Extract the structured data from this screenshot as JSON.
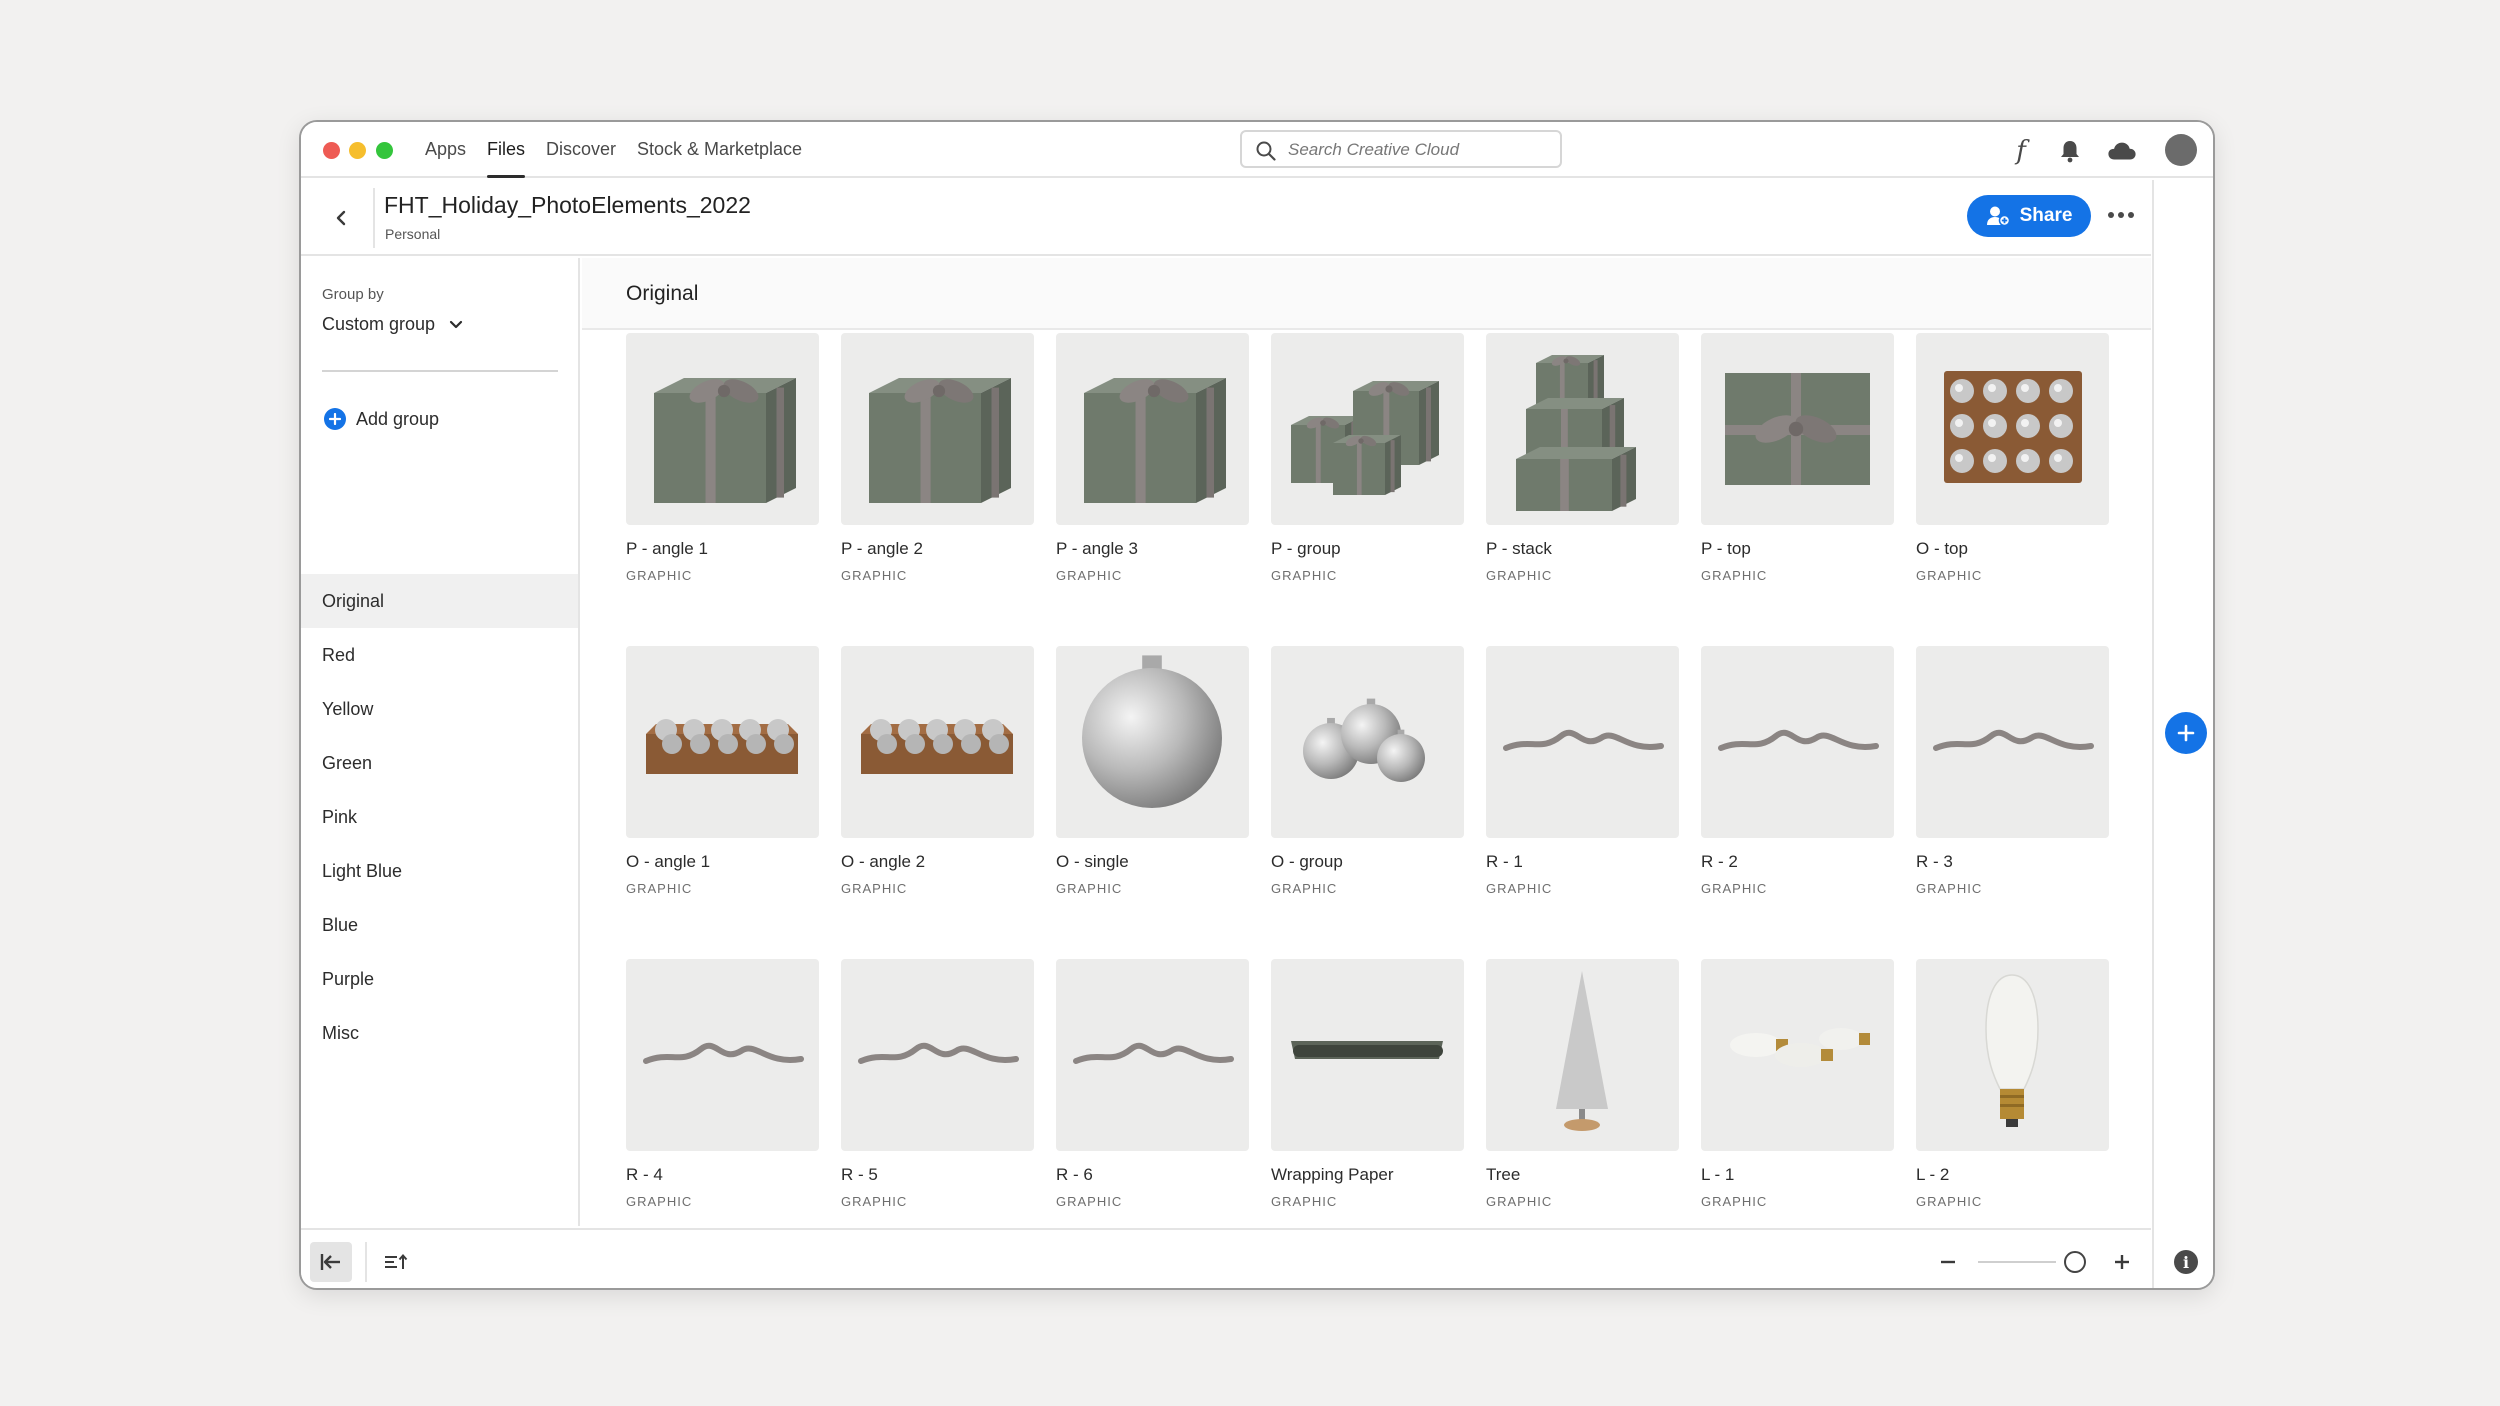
{
  "nav": {
    "tabs": [
      {
        "label": "Apps",
        "active": false
      },
      {
        "label": "Files",
        "active": true
      },
      {
        "label": "Discover",
        "active": false
      },
      {
        "label": "Stock & Marketplace",
        "active": false
      }
    ],
    "search_placeholder": "Search Creative Cloud",
    "icons": [
      "font-icon",
      "bell-icon",
      "cloud-icon",
      "avatar"
    ]
  },
  "header": {
    "title": "FHT_Holiday_PhotoElements_2022",
    "subtitle": "Personal",
    "share_label": "Share"
  },
  "sidebar": {
    "group_by_label": "Group by",
    "group_by_value": "Custom group",
    "add_group_label": "Add group",
    "groups": [
      "Original",
      "Red",
      "Yellow",
      "Green",
      "Pink",
      "Light Blue",
      "Blue",
      "Purple",
      "Misc"
    ],
    "selected_group": "Original"
  },
  "content": {
    "section_title": "Original",
    "items": [
      {
        "name": "P - angle 1",
        "type": "GRAPHIC",
        "kind": "gift-box"
      },
      {
        "name": "P - angle 2",
        "type": "GRAPHIC",
        "kind": "gift-box"
      },
      {
        "name": "P - angle 3",
        "type": "GRAPHIC",
        "kind": "gift-box"
      },
      {
        "name": "P - group",
        "type": "GRAPHIC",
        "kind": "gift-group"
      },
      {
        "name": "P - stack",
        "type": "GRAPHIC",
        "kind": "gift-stack"
      },
      {
        "name": "P - top",
        "type": "GRAPHIC",
        "kind": "gift-top"
      },
      {
        "name": "O - top",
        "type": "GRAPHIC",
        "kind": "ornament-box-top"
      },
      {
        "name": "O - angle 1",
        "type": "GRAPHIC",
        "kind": "ornament-box-angle"
      },
      {
        "name": "O - angle 2",
        "type": "GRAPHIC",
        "kind": "ornament-box-angle"
      },
      {
        "name": "O - single",
        "type": "GRAPHIC",
        "kind": "ornament-single"
      },
      {
        "name": "O - group",
        "type": "GRAPHIC",
        "kind": "ornament-group"
      },
      {
        "name": "R - 1",
        "type": "GRAPHIC",
        "kind": "ribbon"
      },
      {
        "name": "R - 2",
        "type": "GRAPHIC",
        "kind": "ribbon"
      },
      {
        "name": "R - 3",
        "type": "GRAPHIC",
        "kind": "ribbon"
      },
      {
        "name": "R - 4",
        "type": "GRAPHIC",
        "kind": "ribbon"
      },
      {
        "name": "R - 5",
        "type": "GRAPHIC",
        "kind": "ribbon"
      },
      {
        "name": "R - 6",
        "type": "GRAPHIC",
        "kind": "ribbon"
      },
      {
        "name": "Wrapping Paper",
        "type": "GRAPHIC",
        "kind": "wrapping-paper"
      },
      {
        "name": "Tree",
        "type": "GRAPHIC",
        "kind": "tree"
      },
      {
        "name": "L - 1",
        "type": "GRAPHIC",
        "kind": "bulbs"
      },
      {
        "name": "L - 2",
        "type": "GRAPHIC",
        "kind": "bulb-single"
      }
    ]
  },
  "colors": {
    "accent": "#1473e6",
    "gift_green": "#6f7a6c",
    "ribbon_gray": "#8b8583",
    "ornament_silver": "#b9b9b9",
    "crate_brown": "#8a5a35"
  }
}
